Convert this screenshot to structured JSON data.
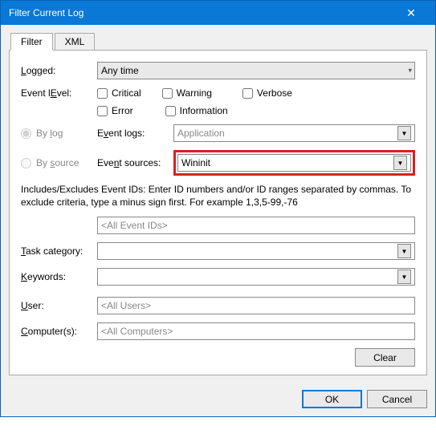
{
  "title": "Filter Current Log",
  "tabs": {
    "filter": "Filter",
    "xml": "XML"
  },
  "labels": {
    "logged": "Logged:",
    "eventlevel": "Event level:",
    "bylog": "By log",
    "bysource": "By source",
    "eventlogs": "Event logs:",
    "eventsources": "Event sources:",
    "taskcategory": "Task category:",
    "keywords": "Keywords:",
    "user": "User:",
    "computers": "Computer(s):",
    "underline": {
      "logged": "L",
      "eventlevel": "E",
      "bylog": "l",
      "bysource": "s",
      "eventlogs": "v",
      "eventsources": "n",
      "task": "T",
      "keywords": "K",
      "user": "U",
      "computers": "C"
    }
  },
  "checkboxes": {
    "critical": "Critical",
    "warning": "Warning",
    "verbose": "Verbose",
    "error": "Error",
    "information": "Information"
  },
  "values": {
    "logged": "Any time",
    "eventlogs": "Application",
    "eventsources": "Wininit",
    "eventids_placeholder": "<All Event IDs>",
    "user_placeholder": "<All Users>",
    "computers_placeholder": "<All Computers>"
  },
  "notes": "Includes/Excludes Event IDs: Enter ID numbers and/or ID ranges separated by commas. To exclude criteria, type a minus sign first. For example 1,3,5-99,-76",
  "buttons": {
    "clear": "Clear",
    "ok": "OK",
    "cancel": "Cancel"
  }
}
